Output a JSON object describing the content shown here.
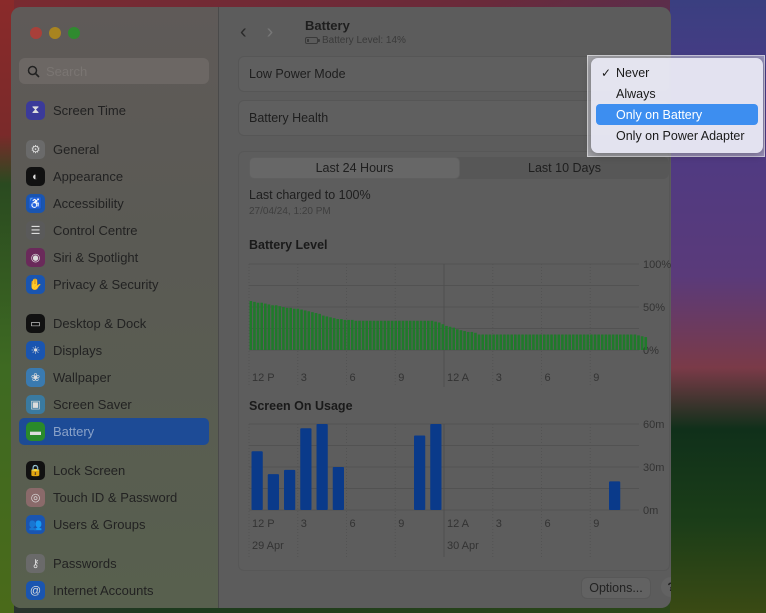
{
  "window": {
    "title": "Battery",
    "subtitle": "Battery Level: 14%"
  },
  "sidebar": {
    "search_placeholder": "Search",
    "groups": [
      [
        {
          "label": "Screen Time",
          "icon": "hourglass-icon",
          "color": "#3b3a9a",
          "glyph": "⧗"
        }
      ],
      [
        {
          "label": "General",
          "icon": "gear-icon",
          "color": "#6a6a6a",
          "glyph": "⚙"
        },
        {
          "label": "Appearance",
          "icon": "appearance-icon",
          "color": "#111111",
          "glyph": "◐"
        },
        {
          "label": "Accessibility",
          "icon": "accessibility-icon",
          "color": "#1a55b0",
          "glyph": "♿"
        },
        {
          "label": "Control Centre",
          "icon": "toggles-icon",
          "color": "#5a5a5a",
          "glyph": "☰"
        },
        {
          "label": "Siri & Spotlight",
          "icon": "siri-icon",
          "color": "#6a2a5a",
          "glyph": "◉"
        },
        {
          "label": "Privacy & Security",
          "icon": "hand-icon",
          "color": "#1a55b0",
          "glyph": "✋"
        }
      ],
      [
        {
          "label": "Desktop & Dock",
          "icon": "dock-icon",
          "color": "#111111",
          "glyph": "▭"
        },
        {
          "label": "Displays",
          "icon": "sun-icon",
          "color": "#1a55b0",
          "glyph": "☀"
        },
        {
          "label": "Wallpaper",
          "icon": "flower-icon",
          "color": "#3a7ab0",
          "glyph": "❀"
        },
        {
          "label": "Screen Saver",
          "icon": "screensaver-icon",
          "color": "#3a7aa0",
          "glyph": "▣"
        },
        {
          "label": "Battery",
          "icon": "battery-icon",
          "color": "#2a8a2a",
          "glyph": "▬",
          "active": true
        }
      ],
      [
        {
          "label": "Lock Screen",
          "icon": "lock-icon",
          "color": "#111111",
          "glyph": "🔒"
        },
        {
          "label": "Touch ID & Password",
          "icon": "fingerprint-icon",
          "color": "#8a6a6a",
          "glyph": "◎"
        },
        {
          "label": "Users & Groups",
          "icon": "users-icon",
          "color": "#1a55b0",
          "glyph": "👥"
        }
      ],
      [
        {
          "label": "Passwords",
          "icon": "key-icon",
          "color": "#6a6a6a",
          "glyph": "⚷"
        },
        {
          "label": "Internet Accounts",
          "icon": "at-icon",
          "color": "#1a55b0",
          "glyph": "@"
        }
      ]
    ]
  },
  "settings": {
    "low_power_mode_label": "Low Power Mode",
    "battery_health_label": "Battery Health"
  },
  "tabs": [
    {
      "label": "Last 24 Hours",
      "active": true
    },
    {
      "label": "Last 10 Days",
      "active": false
    }
  ],
  "last_charged": {
    "label": "Last charged to 100%",
    "date": "27/04/24, 1:20 PM"
  },
  "dropdown": {
    "options": [
      {
        "label": "Never",
        "checked": true,
        "highlighted": false
      },
      {
        "label": "Always",
        "checked": false,
        "highlighted": false
      },
      {
        "label": "Only on Battery",
        "checked": false,
        "highlighted": true
      },
      {
        "label": "Only on Power Adapter",
        "checked": false,
        "highlighted": false
      }
    ],
    "check_glyph": "✓"
  },
  "footer": {
    "options_label": "Options...",
    "help_label": "?"
  },
  "chart_data": [
    {
      "type": "bar",
      "title": "Battery Level",
      "color": "#1f7a2a",
      "x_ticks": [
        "12 P",
        "3",
        "6",
        "9",
        "12 A",
        "3",
        "6",
        "9"
      ],
      "y_ticks": [
        "100%",
        "50%",
        "0%"
      ],
      "ylim": [
        0,
        100
      ],
      "grid": true,
      "values": [
        57,
        56,
        55,
        55,
        54,
        53,
        52,
        52,
        51,
        50,
        49,
        49,
        48,
        48,
        47,
        46,
        45,
        44,
        43,
        42,
        40,
        39,
        38,
        37,
        36,
        36,
        35,
        35,
        35,
        34,
        34,
        34,
        34,
        34,
        34,
        34,
        34,
        34,
        34,
        34,
        34,
        34,
        34,
        34,
        34,
        34,
        34,
        34,
        34,
        34,
        34,
        33,
        32,
        30,
        28,
        27,
        26,
        24,
        23,
        22,
        21,
        21,
        20,
        18,
        18,
        18,
        18,
        18,
        18,
        18,
        18,
        18,
        18,
        18,
        18,
        18,
        18,
        18,
        18,
        18,
        18,
        18,
        18,
        18,
        18,
        18,
        18,
        18,
        18,
        18,
        18,
        18,
        18,
        18,
        18,
        18,
        18,
        18,
        18,
        18,
        18,
        18,
        18,
        18,
        18,
        18,
        18,
        17,
        16,
        15
      ]
    },
    {
      "type": "bar",
      "title": "Screen On Usage",
      "color": "#0a3a8a",
      "x_ticks": [
        "12 P",
        "3",
        "6",
        "9",
        "12 A",
        "3",
        "6",
        "9"
      ],
      "date_labels": [
        "29 Apr",
        "30 Apr"
      ],
      "y_ticks": [
        "60m",
        "30m",
        "0m"
      ],
      "ylim": [
        0,
        60
      ],
      "grid": true,
      "hours": [
        "12P",
        "1P",
        "2P",
        "3P",
        "4P",
        "5P",
        "6P",
        "7P",
        "8P",
        "9P",
        "10P",
        "11P",
        "12A",
        "1A",
        "2A",
        "3A",
        "4A",
        "5A",
        "6A",
        "7A",
        "8A",
        "9A",
        "10A",
        "11A"
      ],
      "values": [
        41,
        25,
        28,
        57,
        60,
        30,
        0,
        0,
        0,
        0,
        52,
        60,
        0,
        0,
        0,
        0,
        0,
        0,
        0,
        0,
        0,
        0,
        20,
        0
      ]
    }
  ]
}
